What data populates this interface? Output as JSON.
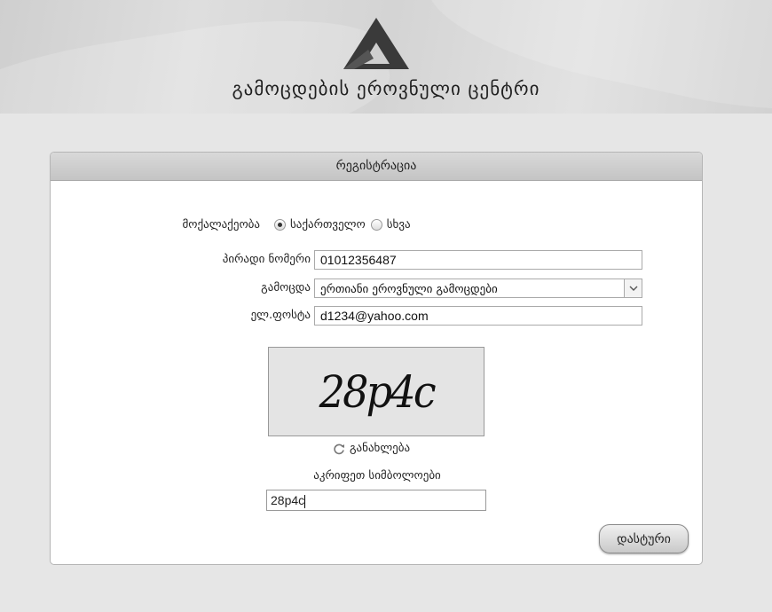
{
  "header": {
    "title": "გამოცდების ეროვნული ცენტრი",
    "logo_icon": "nacc-triangle-logo-icon"
  },
  "form": {
    "panel_title": "რეგისტრაცია",
    "citizenship": {
      "label": "მოქალაქეობა",
      "options": [
        {
          "label": "საქართველო",
          "selected": true
        },
        {
          "label": "სხვა",
          "selected": false
        }
      ]
    },
    "personal_id": {
      "label": "პირადი ნომერი",
      "value": "01012356487"
    },
    "exam": {
      "label": "გამოცდა",
      "value": "ერთიანი ეროვნული გამოცდები"
    },
    "email": {
      "label": "ელ.ფოსტა",
      "value": "d1234@yahoo.com"
    },
    "captcha": {
      "image_text": "28p4c",
      "refresh_label": "განახლება",
      "prompt": "აკრიფეთ სიმბოლოები",
      "input_value": "28p4c"
    },
    "submit_label": "დასტური"
  },
  "colors": {
    "page_bg": "#e6e6e6",
    "panel_header": "#c9c9c9",
    "logo": "#3a3a3a"
  }
}
